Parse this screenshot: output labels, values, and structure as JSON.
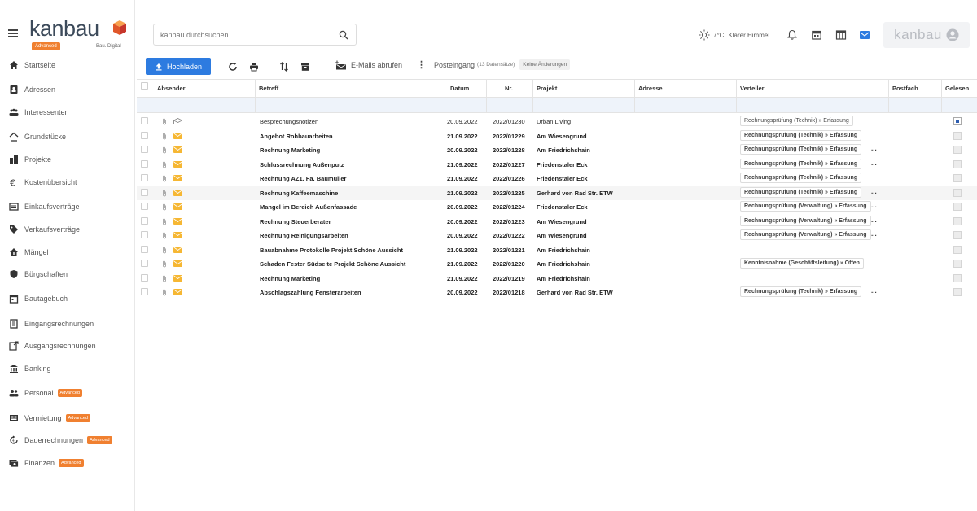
{
  "app": {
    "logo_text": "kanbau",
    "logo_badge": "Advanced",
    "logo_sub": "Bau. Digital",
    "brand_color": "#f08030",
    "accent_color": "#2d7be0"
  },
  "sidebar": {
    "items": [
      {
        "label": "Startseite",
        "icon": "home-icon"
      },
      {
        "label": "Adressen",
        "icon": "address-book-icon"
      },
      {
        "label": "Interessenten",
        "icon": "people-icon"
      },
      {
        "label": "Grundstücke",
        "icon": "plot-icon"
      },
      {
        "label": "Projekte",
        "icon": "buildings-icon"
      },
      {
        "label": "Kostenübersicht",
        "icon": "euro-icon"
      },
      {
        "label": "Einkaufsverträge",
        "icon": "contract-icon"
      },
      {
        "label": "Verkaufsverträge",
        "icon": "tag-icon"
      },
      {
        "label": "Mängel",
        "icon": "house-defect-icon"
      },
      {
        "label": "Bürgschaften",
        "icon": "shield-icon"
      },
      {
        "label": "Bautagebuch",
        "icon": "calendar-icon"
      },
      {
        "label": "Eingangsrechnungen",
        "icon": "invoice-in-icon"
      },
      {
        "label": "Ausgangsrechnungen",
        "icon": "invoice-out-icon"
      },
      {
        "label": "Banking",
        "icon": "bank-icon"
      },
      {
        "label": "Personal",
        "icon": "staff-icon",
        "badge": "Advanced"
      },
      {
        "label": "Vermietung",
        "icon": "rental-icon",
        "badge": "Advanced"
      },
      {
        "label": "Dauerrechnungen",
        "icon": "recurring-icon",
        "badge": "Advanced"
      },
      {
        "label": "Finanzen",
        "icon": "finance-icon",
        "badge": "Advanced"
      }
    ]
  },
  "header": {
    "search_placeholder": "kanbau durchsuchen",
    "weather_temp": "7°C",
    "weather_text": "Klarer Himmel",
    "user_text": "kanbau"
  },
  "toolbar": {
    "upload_label": "Hochladen",
    "fetch_mails_label": "E-Mails abrufen",
    "inbox_label": "Posteingang",
    "inbox_count": "(13 Datensätze)",
    "no_changes_label": "Keine Änderungen"
  },
  "table": {
    "columns": {
      "sender": "Absender",
      "subject": "Betreff",
      "date": "Datum",
      "number": "Nr.",
      "project": "Projekt",
      "address": "Adresse",
      "distributor": "Verteiler",
      "mailbox": "Postfach",
      "read": "Gelesen"
    },
    "rows": [
      {
        "subject": "Besprechungsnotizen",
        "date": "20.09.2022",
        "number": "2022/01230",
        "project": "Urban Living",
        "distributor": "Rechnungsprüfung (Technik) » Erfassung",
        "more": "",
        "read": true,
        "unread": false
      },
      {
        "subject": "Angebot Rohbauarbeiten",
        "date": "21.09.2022",
        "number": "2022/01229",
        "project": "Am Wiesengrund",
        "distributor": "Rechnungsprüfung (Technik) » Erfassung",
        "more": "",
        "read": false,
        "unread": true
      },
      {
        "subject": "Rechnung Marketing",
        "date": "20.09.2022",
        "number": "2022/01228",
        "project": "Am Friedrichshain",
        "distributor": "Rechnungsprüfung (Technik) » Erfassung",
        "more": "...",
        "read": false,
        "unread": true
      },
      {
        "subject": "Schlussrechnung Außenputz",
        "date": "21.09.2022",
        "number": "2022/01227",
        "project": "Friedenstaler Eck",
        "distributor": "Rechnungsprüfung (Technik) » Erfassung",
        "more": "...",
        "read": false,
        "unread": true
      },
      {
        "subject": "Rechnung AZ1. Fa. Baumüller",
        "date": "21.09.2022",
        "number": "2022/01226",
        "project": "Friedenstaler Eck",
        "distributor": "Rechnungsprüfung (Technik) » Erfassung",
        "more": "",
        "read": false,
        "unread": true
      },
      {
        "subject": "Rechnung Kaffeemaschine",
        "date": "21.09.2022",
        "number": "2022/01225",
        "project": "Gerhard von Rad Str. ETW",
        "distributor": "Rechnungsprüfung (Technik) » Erfassung",
        "more": "...",
        "read": false,
        "unread": true
      },
      {
        "subject": "Mangel im Bereich Außenfassade",
        "date": "20.09.2022",
        "number": "2022/01224",
        "project": "Friedenstaler Eck",
        "distributor": "Rechnungsprüfung (Verwaltung) » Erfassung",
        "more": "...",
        "read": false,
        "unread": true
      },
      {
        "subject": "Rechnung Steuerberater",
        "date": "20.09.2022",
        "number": "2022/01223",
        "project": "Am Wiesengrund",
        "distributor": "Rechnungsprüfung (Verwaltung) » Erfassung",
        "more": "...",
        "read": false,
        "unread": true
      },
      {
        "subject": "Rechnung Reinigungsarbeiten",
        "date": "20.09.2022",
        "number": "2022/01222",
        "project": "Am Wiesengrund",
        "distributor": "Rechnungsprüfung (Verwaltung) » Erfassung",
        "more": "...",
        "read": false,
        "unread": true
      },
      {
        "subject": "Bauabnahme Protokolle Projekt Schöne Aussicht",
        "date": "21.09.2022",
        "number": "2022/01221",
        "project": "Am Friedrichshain",
        "distributor": "",
        "more": "",
        "read": false,
        "unread": true
      },
      {
        "subject": "Schaden Fester Südseite Projekt Schöne Aussicht",
        "date": "21.09.2022",
        "number": "2022/01220",
        "project": "Am Friedrichshain",
        "distributor": "Kenntnisnahme (Geschäftsleitung) » Offen",
        "more": "",
        "read": false,
        "unread": true
      },
      {
        "subject": "Rechnung Marketing",
        "date": "21.09.2022",
        "number": "2022/01219",
        "project": "Am Friedrichshain",
        "distributor": "",
        "more": "",
        "read": false,
        "unread": true
      },
      {
        "subject": "Abschlagszahlung Fensterarbeiten",
        "date": "20.09.2022",
        "number": "2022/01218",
        "project": "Gerhard von Rad Str. ETW",
        "distributor": "Rechnungsprüfung (Technik) » Erfassung",
        "more": "...",
        "read": false,
        "unread": true
      }
    ]
  }
}
